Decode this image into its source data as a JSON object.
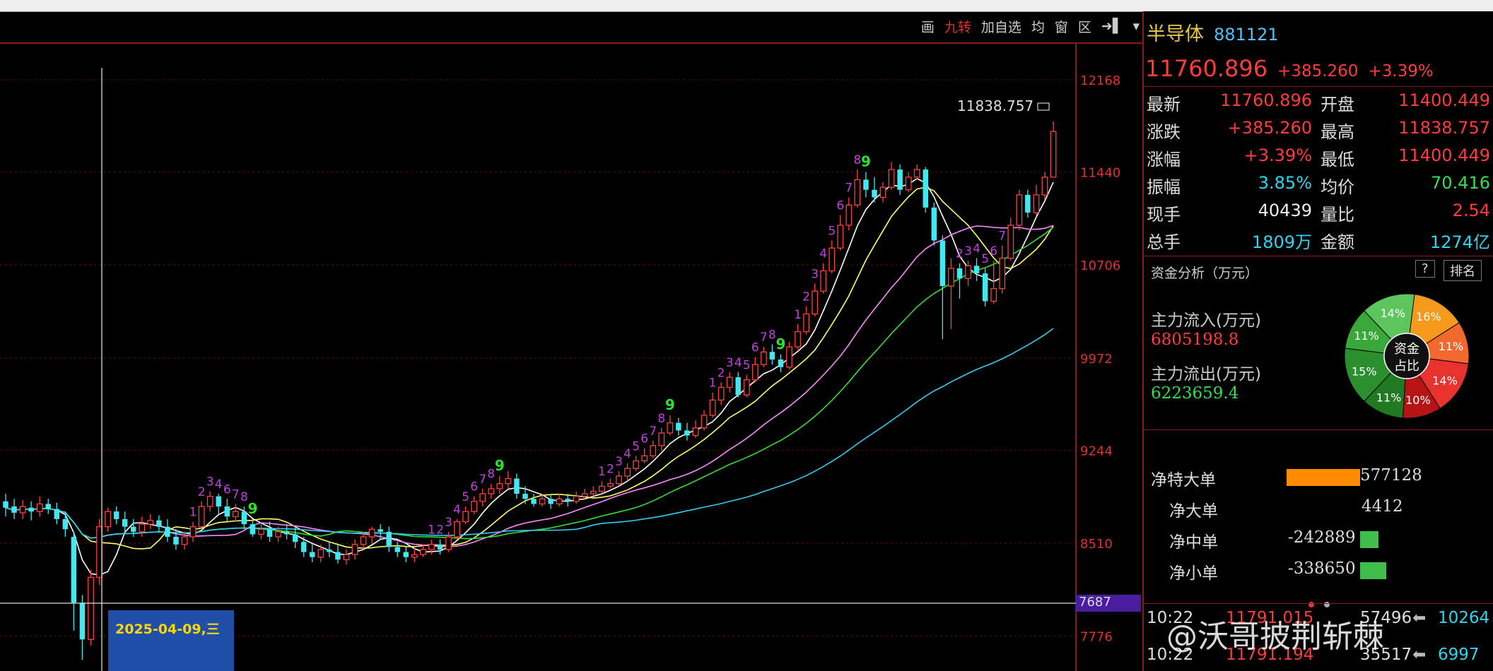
{
  "toolbar": {
    "items": [
      "画",
      "九转",
      "加自选",
      "均",
      "窗",
      "区"
    ],
    "active": "九转"
  },
  "quote": {
    "name": "半导体",
    "code": "881121",
    "price": "11760.896",
    "change": "+385.260",
    "change_pct": "+3.39%"
  },
  "stats": [
    {
      "l1": "最新",
      "v1": "11760.896",
      "c1": "red",
      "l2": "开盘",
      "v2": "11400.449",
      "c2": "red"
    },
    {
      "l1": "涨跌",
      "v1": "+385.260",
      "c1": "red",
      "l2": "最高",
      "v2": "11838.757",
      "c2": "red"
    },
    {
      "l1": "涨幅",
      "v1": "+3.39%",
      "c1": "red",
      "l2": "最低",
      "v2": "11400.449",
      "c2": "red"
    },
    {
      "l1": "振幅",
      "v1": "3.85%",
      "c1": "cyan",
      "l2": "均价",
      "v2": "70.416",
      "c2": "green"
    },
    {
      "l1": "现手",
      "v1": "40439",
      "c1": "white",
      "l2": "量比",
      "v2": "2.54",
      "c2": "red"
    },
    {
      "l1": "总手",
      "v1": "1809万",
      "c1": "cyan",
      "l2": "金额",
      "v2": "1274亿",
      "c2": "cyan"
    }
  ],
  "fund": {
    "title": "资金分析（万元）",
    "help": "?",
    "rank": "排名",
    "inflow_label": "主力流入(万元)",
    "inflow_value": "6805198.8",
    "outflow_label": "主力流出(万元)",
    "outflow_value": "6223659.4",
    "pie_center_1": "资金",
    "pie_center_2": "占比",
    "pie": [
      {
        "pct": 16,
        "label": "16%",
        "color": "#f39a1d"
      },
      {
        "pct": 11,
        "label": "11%",
        "color": "#f2692d"
      },
      {
        "pct": 14,
        "label": "14%",
        "color": "#e8322e"
      },
      {
        "pct": 10,
        "label": "10%",
        "color": "#b71515"
      },
      {
        "pct": 11,
        "label": "11%",
        "color": "#1f7a22"
      },
      {
        "pct": 15,
        "label": "15%",
        "color": "#2a8f2c"
      },
      {
        "pct": 11,
        "label": "11%",
        "color": "#38a83a"
      },
      {
        "pct": 14,
        "label": "14%",
        "color": "#5cc55e"
      }
    ]
  },
  "orders": [
    {
      "label": "净特大单",
      "value": "577128",
      "num": 577128,
      "color": "#ff8c00"
    },
    {
      "label": "净大单",
      "value": "4412",
      "num": 4412,
      "color": "#ff8c00"
    },
    {
      "label": "净中单",
      "value": "-242889",
      "num": -242889,
      "color": "#3fbf4a"
    },
    {
      "label": "净小单",
      "value": "-338650",
      "num": -338650,
      "color": "#3fbf4a"
    }
  ],
  "ticks": [
    {
      "time": "10:22",
      "price": "11791.015",
      "vol": "57496",
      "arrow": "⬅",
      "amount": "10264"
    },
    {
      "time": "10:22",
      "price": "11791.194",
      "vol": "35517",
      "arrow": "⬅",
      "amount": "6997"
    }
  ],
  "watermark": "@沃哥披荆斩棘",
  "chart_data": {
    "type": "candlestick",
    "y_ticks": [
      12168,
      11440,
      10706,
      9972,
      9244,
      8510,
      7776
    ],
    "ylim": [
      7590,
      12330
    ],
    "current_label": "7687",
    "high_label": "11838.757",
    "cursor_date": "2025-04-09,三",
    "candles": [
      [
        8840,
        8790,
        8900,
        8720
      ],
      [
        8800,
        8750,
        8860,
        8700
      ],
      [
        8750,
        8800,
        8850,
        8700
      ],
      [
        8790,
        8760,
        8840,
        8690
      ],
      [
        8760,
        8820,
        8880,
        8720
      ],
      [
        8820,
        8780,
        8860,
        8740
      ],
      [
        8780,
        8700,
        8830,
        8660
      ],
      [
        8700,
        8620,
        8760,
        8560
      ],
      [
        8560,
        8040,
        8600,
        7820
      ],
      [
        8040,
        7750,
        8100,
        7590
      ],
      [
        7750,
        8240,
        8300,
        7700
      ],
      [
        8240,
        8640,
        8700,
        8180
      ],
      [
        8640,
        8760,
        8790,
        8600
      ],
      [
        8760,
        8700,
        8800,
        8660
      ],
      [
        8700,
        8640,
        8760,
        8600
      ],
      [
        8640,
        8600,
        8700,
        8560
      ],
      [
        8600,
        8660,
        8720,
        8560
      ],
      [
        8660,
        8690,
        8740,
        8620
      ],
      [
        8690,
        8640,
        8730,
        8600
      ],
      [
        8640,
        8560,
        8700,
        8520
      ],
      [
        8560,
        8500,
        8620,
        8460
      ],
      [
        8500,
        8560,
        8600,
        8460
      ],
      [
        8560,
        8640,
        8680,
        8520
      ],
      [
        8640,
        8800,
        8840,
        8620
      ],
      [
        8800,
        8880,
        8920,
        8760
      ],
      [
        8880,
        8800,
        8900,
        8740
      ],
      [
        8800,
        8720,
        8860,
        8680
      ],
      [
        8720,
        8760,
        8820,
        8680
      ],
      [
        8760,
        8660,
        8800,
        8620
      ],
      [
        8660,
        8580,
        8700,
        8560
      ],
      [
        8580,
        8620,
        8660,
        8540
      ],
      [
        8620,
        8560,
        8680,
        8520
      ],
      [
        8560,
        8600,
        8640,
        8520
      ],
      [
        8600,
        8580,
        8660,
        8540
      ],
      [
        8580,
        8520,
        8640,
        8470
      ],
      [
        8520,
        8440,
        8560,
        8400
      ],
      [
        8440,
        8400,
        8500,
        8360
      ],
      [
        8400,
        8460,
        8500,
        8360
      ],
      [
        8460,
        8440,
        8520,
        8400
      ],
      [
        8440,
        8380,
        8500,
        8350
      ],
      [
        8380,
        8420,
        8460,
        8340
      ],
      [
        8420,
        8500,
        8540,
        8380
      ],
      [
        8500,
        8560,
        8600,
        8460
      ],
      [
        8560,
        8620,
        8640,
        8500
      ],
      [
        8620,
        8600,
        8660,
        8540
      ],
      [
        8600,
        8480,
        8640,
        8440
      ],
      [
        8480,
        8440,
        8520,
        8400
      ],
      [
        8440,
        8400,
        8480,
        8360
      ],
      [
        8400,
        8420,
        8470,
        8360
      ],
      [
        8420,
        8460,
        8500,
        8400
      ],
      [
        8460,
        8500,
        8540,
        8420
      ],
      [
        8500,
        8460,
        8540,
        8420
      ],
      [
        8460,
        8560,
        8600,
        8440
      ],
      [
        8560,
        8680,
        8700,
        8540
      ],
      [
        8680,
        8760,
        8800,
        8660
      ],
      [
        8760,
        8840,
        8880,
        8740
      ],
      [
        8840,
        8900,
        8940,
        8800
      ],
      [
        8900,
        8940,
        8980,
        8860
      ],
      [
        8940,
        8980,
        9040,
        8900
      ],
      [
        8980,
        9020,
        9080,
        8940
      ],
      [
        9020,
        8900,
        9060,
        8860
      ],
      [
        8900,
        8860,
        8960,
        8820
      ],
      [
        8860,
        8820,
        8900,
        8800
      ],
      [
        8820,
        8860,
        8900,
        8800
      ],
      [
        8860,
        8820,
        8900,
        8780
      ],
      [
        8820,
        8860,
        8900,
        8800
      ],
      [
        8860,
        8840,
        8900,
        8800
      ],
      [
        8840,
        8880,
        8920,
        8820
      ],
      [
        8880,
        8900,
        8940,
        8860
      ],
      [
        8900,
        8920,
        8960,
        8880
      ],
      [
        8920,
        8960,
        9000,
        8900
      ],
      [
        8960,
        8980,
        9020,
        8940
      ],
      [
        8980,
        9040,
        9080,
        8960
      ],
      [
        9040,
        9100,
        9140,
        9000
      ],
      [
        9100,
        9160,
        9200,
        9080
      ],
      [
        9160,
        9200,
        9260,
        9140
      ],
      [
        9200,
        9280,
        9320,
        9180
      ],
      [
        9280,
        9380,
        9420,
        9240
      ],
      [
        9380,
        9460,
        9520,
        9360
      ],
      [
        9460,
        9400,
        9500,
        9360
      ],
      [
        9400,
        9360,
        9460,
        9320
      ],
      [
        9360,
        9420,
        9480,
        9340
      ],
      [
        9420,
        9520,
        9560,
        9400
      ],
      [
        9520,
        9640,
        9700,
        9500
      ],
      [
        9640,
        9740,
        9780,
        9600
      ],
      [
        9740,
        9820,
        9860,
        9700
      ],
      [
        9820,
        9680,
        9860,
        9660
      ],
      [
        9680,
        9800,
        9840,
        9660
      ],
      [
        9800,
        9920,
        9980,
        9780
      ],
      [
        9920,
        10020,
        10060,
        9900
      ],
      [
        10020,
        9960,
        10080,
        9920
      ],
      [
        9960,
        9900,
        10000,
        9860
      ],
      [
        9900,
        10060,
        10100,
        9880
      ],
      [
        10060,
        10180,
        10240,
        10040
      ],
      [
        10180,
        10320,
        10380,
        10160
      ],
      [
        10320,
        10500,
        10560,
        10300
      ],
      [
        10500,
        10660,
        10720,
        10480
      ],
      [
        10660,
        10840,
        10900,
        10640
      ],
      [
        10840,
        11020,
        11100,
        10820
      ],
      [
        11020,
        11180,
        11240,
        10980
      ],
      [
        11180,
        11380,
        11460,
        11160
      ],
      [
        11380,
        11300,
        11440,
        11240
      ],
      [
        11300,
        11240,
        11400,
        11200
      ],
      [
        11240,
        11320,
        11360,
        11200
      ],
      [
        11320,
        11460,
        11520,
        11300
      ],
      [
        11460,
        11300,
        11500,
        11260
      ],
      [
        11300,
        11400,
        11440,
        11280
      ],
      [
        11400,
        11460,
        11500,
        11380
      ],
      [
        11460,
        11160,
        11480,
        11120
      ],
      [
        11160,
        10900,
        11200,
        10860
      ],
      [
        10900,
        10540,
        10940,
        10120
      ],
      [
        10540,
        10680,
        10760,
        10200
      ],
      [
        10680,
        10600,
        10720,
        10440
      ],
      [
        10600,
        10700,
        10740,
        10540
      ],
      [
        10700,
        10640,
        10760,
        10580
      ],
      [
        10640,
        10420,
        10680,
        10380
      ],
      [
        10420,
        10520,
        10740,
        10400
      ],
      [
        10520,
        10760,
        10860,
        10480
      ],
      [
        10760,
        11020,
        11080,
        10740
      ],
      [
        11020,
        11260,
        11300,
        10980
      ],
      [
        11260,
        11120,
        11300,
        11080
      ],
      [
        11120,
        11260,
        11340,
        11100
      ],
      [
        11260,
        11400,
        11440,
        11220
      ],
      [
        11400,
        11760,
        11840,
        11400
      ]
    ],
    "td_labels": [
      [
        22,
        "1",
        "#c040e0"
      ],
      [
        23,
        "2",
        "#c040e0"
      ],
      [
        24,
        "3",
        "#c040e0"
      ],
      [
        25,
        "4",
        "#c040e0"
      ],
      [
        26,
        "6",
        "#c040e0"
      ],
      [
        27,
        "7",
        "#c040e0"
      ],
      [
        28,
        "8",
        "#c040e0"
      ],
      [
        29,
        "9",
        "#2ee02e"
      ],
      [
        50,
        "1",
        "#c040e0"
      ],
      [
        51,
        "2",
        "#c040e0"
      ],
      [
        52,
        "3",
        "#c040e0"
      ],
      [
        53,
        "4",
        "#c040e0"
      ],
      [
        54,
        "5",
        "#c040e0"
      ],
      [
        55,
        "6",
        "#c040e0"
      ],
      [
        56,
        "7",
        "#c040e0"
      ],
      [
        57,
        "8",
        "#c040e0"
      ],
      [
        58,
        "9",
        "#2ee02e"
      ],
      [
        70,
        "1",
        "#c040e0"
      ],
      [
        71,
        "2",
        "#c040e0"
      ],
      [
        72,
        "3",
        "#c040e0"
      ],
      [
        73,
        "4",
        "#c040e0"
      ],
      [
        74,
        "5",
        "#c040e0"
      ],
      [
        75,
        "6",
        "#c040e0"
      ],
      [
        76,
        "7",
        "#c040e0"
      ],
      [
        77,
        "8",
        "#c040e0"
      ],
      [
        78,
        "9",
        "#2ee02e"
      ],
      [
        83,
        "1",
        "#c040e0"
      ],
      [
        84,
        "2",
        "#c040e0"
      ],
      [
        85,
        "3",
        "#c040e0"
      ],
      [
        86,
        "4",
        "#c040e0"
      ],
      [
        87,
        "5",
        "#c040e0"
      ],
      [
        88,
        "6",
        "#c040e0"
      ],
      [
        89,
        "7",
        "#c040e0"
      ],
      [
        90,
        "8",
        "#c040e0"
      ],
      [
        91,
        "9",
        "#2ee02e"
      ],
      [
        93,
        "1",
        "#c040e0"
      ],
      [
        94,
        "2",
        "#c040e0"
      ],
      [
        95,
        "3",
        "#c040e0"
      ],
      [
        96,
        "4",
        "#c040e0"
      ],
      [
        97,
        "5",
        "#c040e0"
      ],
      [
        98,
        "6",
        "#c040e0"
      ],
      [
        99,
        "7",
        "#c040e0"
      ],
      [
        100,
        "8",
        "#c040e0"
      ],
      [
        101,
        "9",
        "#2ee02e"
      ],
      [
        112,
        "2",
        "#c040e0"
      ],
      [
        113,
        "3",
        "#c040e0"
      ],
      [
        114,
        "4",
        "#c040e0"
      ],
      [
        115,
        "5",
        "#c040e0"
      ],
      [
        116,
        "6",
        "#c040e0"
      ],
      [
        117,
        "7",
        "#c040e0"
      ]
    ],
    "ma": [
      {
        "color": "#ffffff",
        "period": 5
      },
      {
        "color": "#ffff66",
        "period": 10
      },
      {
        "color": "#ff88ff",
        "period": 20
      },
      {
        "color": "#33dd33",
        "period": 30
      },
      {
        "color": "#33ccee",
        "period": 60
      }
    ]
  }
}
